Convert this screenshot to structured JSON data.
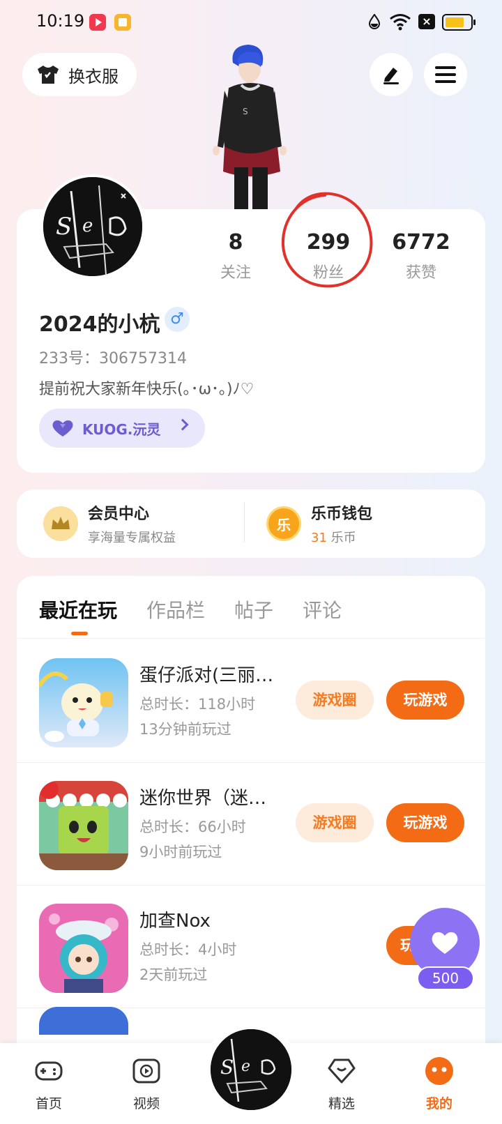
{
  "status_bar": {
    "time": "10:19"
  },
  "header": {
    "outfit_label": "换衣服"
  },
  "profile": {
    "stats": [
      {
        "value": "8",
        "label": "关注"
      },
      {
        "value": "299",
        "label": "粉丝"
      },
      {
        "value": "6772",
        "label": "获赞"
      }
    ],
    "username": "2024的小杭",
    "gender_symbol": "♂",
    "uid": "233号：306757314",
    "bio": "提前祝大家新年快乐(｡･ω･｡)ﾉ♡",
    "guild": "KUOG.沅灵"
  },
  "member": {
    "vip_title": "会员中心",
    "vip_sub": "享海量专属权益",
    "wallet_title": "乐币钱包",
    "wallet_amount": "31",
    "wallet_unit": " 乐币",
    "wallet_icon_char": "乐"
  },
  "tabs": [
    "最近在玩",
    "作品栏",
    "帖子",
    "评论"
  ],
  "games": [
    {
      "name": "蛋仔派对(三丽…",
      "duration": "总时长：118小时",
      "last_played": "13分钟前玩过"
    },
    {
      "name": "迷你世界（迷…",
      "duration": "总时长：66小时",
      "last_played": "9小时前玩过"
    },
    {
      "name": "加查Nox",
      "duration": "总时长：4小时",
      "last_played": "2天前玩过"
    }
  ],
  "buttons": {
    "circle": "游戏圈",
    "play": "玩游戏",
    "play_partial": "玩"
  },
  "float_like": {
    "count": "500"
  },
  "nav": [
    {
      "label": "首页"
    },
    {
      "label": "视频"
    },
    {
      "label": "精选"
    },
    {
      "label": "我的"
    }
  ],
  "colors": {
    "accent": "#f46b16",
    "purple": "#8e72f4",
    "guild": "#6b5ccf"
  }
}
